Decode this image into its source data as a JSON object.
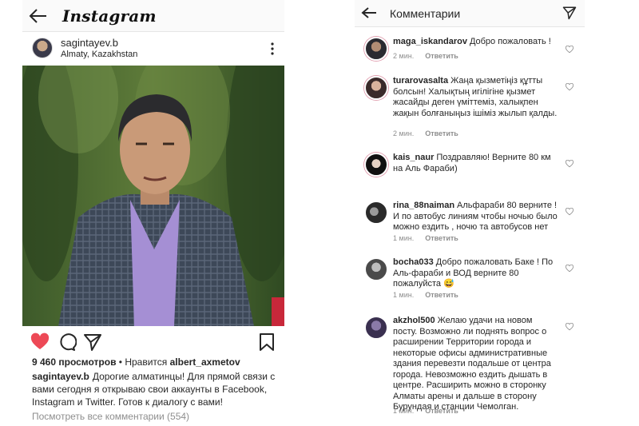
{
  "post": {
    "header": {
      "logo": "Instagram"
    },
    "username": "sagintayev.b",
    "location": "Almaty, Kazakhstan",
    "views_count": "9 460 просмотров",
    "views_sep": " • Нравится ",
    "liked_by": "albert_axmetov",
    "caption_user": "sagintayev.b",
    "caption_text": "Дорогие алматинцы! Для прямой связи с вами сегодня я открываю свои аккаунты в Facebook, Instagram и Twitter. Готов к диалогу с вами!",
    "view_all_comments": "Посмотреть все комментарии (554)",
    "colors": {
      "like": "#ed4956",
      "muted": "#8e8e8e",
      "text": "#262626"
    }
  },
  "comments_panel": {
    "title": "Комментарии",
    "comments": [
      {
        "user": "maga_iskandarov",
        "text": "Добро пожаловать !",
        "time": "2 мин.",
        "reply": "Ответить"
      },
      {
        "user": "turarovasalta",
        "text": "Жаңа қызметіңіз құтты болсын! Халықтың игілігіне қызмет жасайды деген үміттеміз, халықпен жақын болғаныңыз ішіміз жылып қалды.",
        "time": "2 мин.",
        "reply": "Ответить"
      },
      {
        "user": "kais_naur",
        "text": "Поздравляю! Верните 80 км на Аль Фараби)",
        "time": "",
        "reply": ""
      },
      {
        "user": "rina_88naiman",
        "text": "Альфараби 80 верните ! И по автобус линиям чтобы ночью было можно ездить , ночю та автобусов нет",
        "time": "1 мин.",
        "reply": "Ответить"
      },
      {
        "user": "bocha033",
        "text": "Добро пожаловать Баке ! По Аль-фараби и ВОД верните 80 пожалуйста 😅",
        "time": "1 мин.",
        "reply": "Ответить"
      },
      {
        "user": "akzhol500",
        "text": "Желаю удачи на новом посту. Возможно ли поднять вопрос о расширении Территории города и некоторые офисы административные здания перевезти подальше от центра города. Невозможно ездить дышать в центре. Расширить можно в сторонку Алматы арены и дальше в сторону Бурундая и станции Чемолган.",
        "time": "1 мин.",
        "reply": "Ответить"
      }
    ]
  }
}
